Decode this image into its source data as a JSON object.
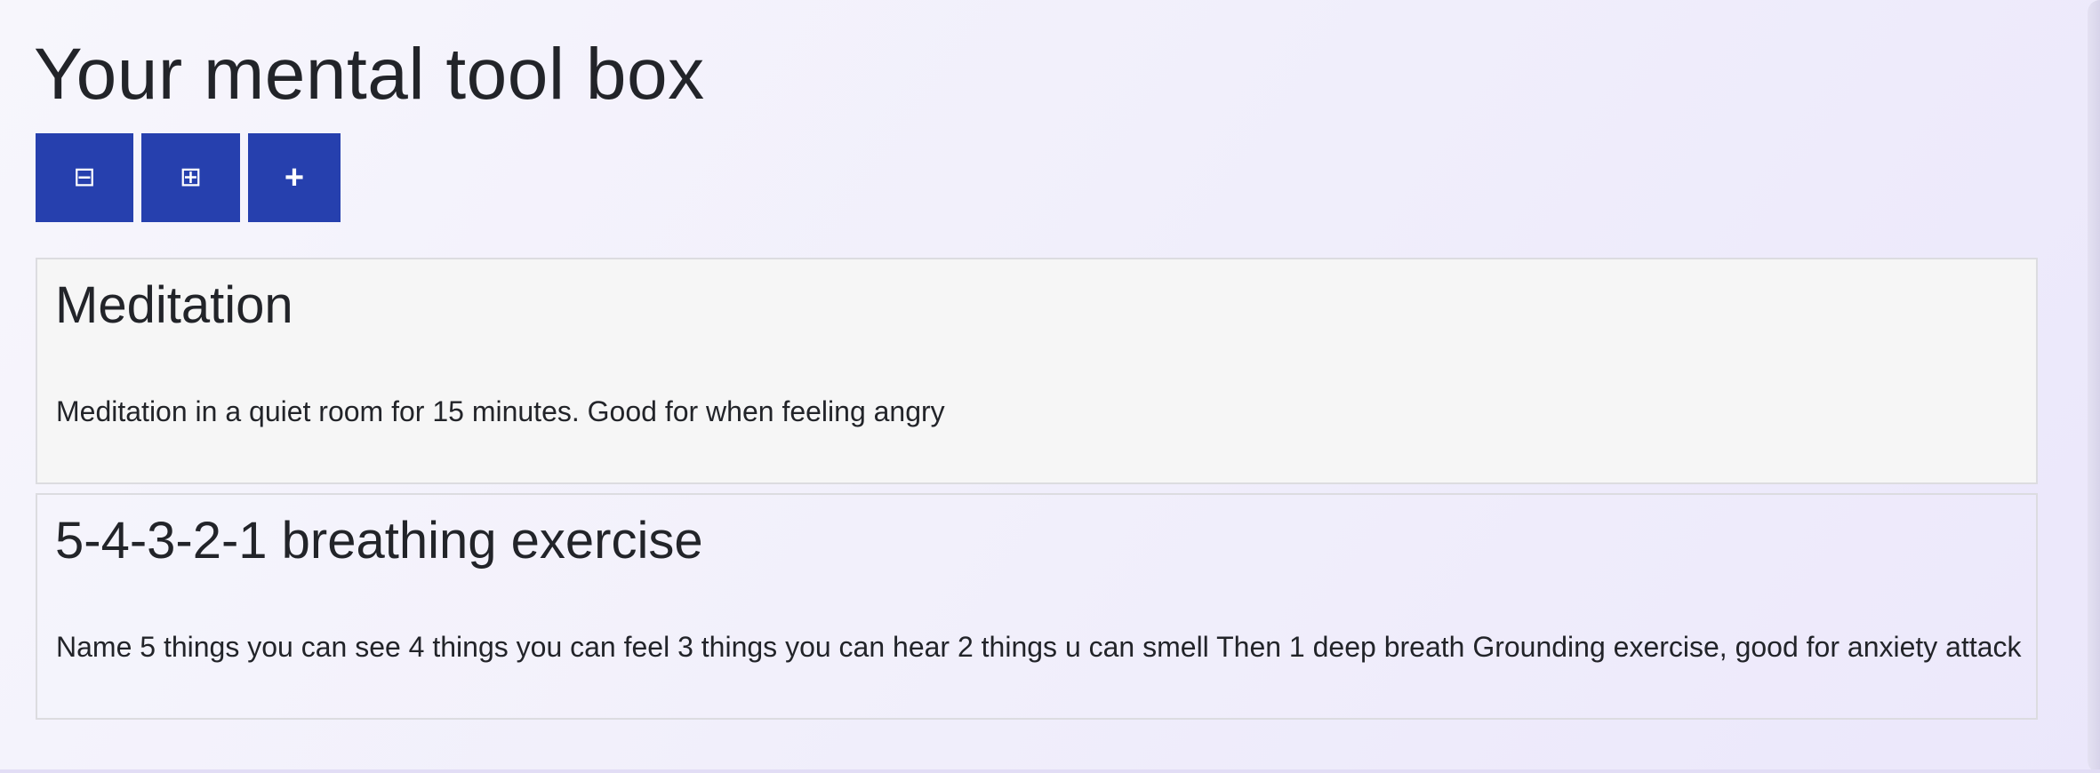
{
  "page": {
    "title": "Your mental tool box"
  },
  "toolbar": {
    "buttons": [
      {
        "icon": "collapse-view-icon",
        "glyph": "⊟"
      },
      {
        "icon": "grid-view-icon",
        "glyph": "⊞"
      },
      {
        "icon": "add-icon",
        "glyph": "+"
      }
    ],
    "color": "#2640ae"
  },
  "tools": [
    {
      "title": "Meditation",
      "description": "Meditation in a quiet room for 15 minutes. Good for when feeling angry"
    },
    {
      "title": "5-4-3-2-1 breathing exercise",
      "description": "Name 5 things you can see 4 things you can feel 3 things you can hear 2 things u can smell Then 1 deep breath Grounding exercise, good for anxiety attack"
    }
  ]
}
